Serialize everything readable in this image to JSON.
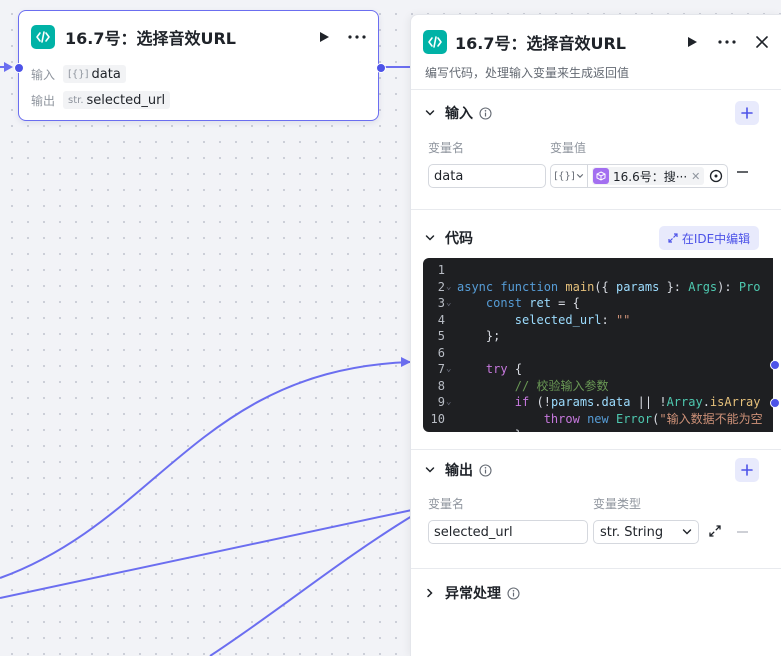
{
  "node": {
    "title": "16.7号：选择音效URL",
    "input_label": "输入",
    "input_type": "[{}]",
    "input_name": "data",
    "output_label": "输出",
    "output_type": "str.",
    "output_name": "selected_url"
  },
  "panel": {
    "title": "16.7号：选择音效URL",
    "subtitle": "编写代码，处理输入变量来生成返回值",
    "input_section": {
      "title": "输入",
      "col_name": "变量名",
      "col_value": "变量值",
      "var_name": "data",
      "type_tag": "[{}]",
      "ref_label": "16.6号：搜···"
    },
    "code_section": {
      "title": "代码",
      "ide_button": "在IDE中编辑",
      "lines": [
        {
          "n": "1",
          "fold": "",
          "html": ""
        },
        {
          "n": "2",
          "fold": "v",
          "html": "<span class='kw2'>async</span> <span class='kw2'>function</span> <span class='fn'>main</span>({ <span class='prm'>params</span> }: <span class='typ'>Args</span>): <span class='typ'>Pro</span>"
        },
        {
          "n": "3",
          "fold": "v",
          "html": "    <span class='kw2'>const</span> <span class='prm'>ret</span> = {"
        },
        {
          "n": "4",
          "fold": "",
          "html": "        <span class='prm'>selected_url</span>: <span class='str'>\"\"</span>"
        },
        {
          "n": "5",
          "fold": "",
          "html": "    };"
        },
        {
          "n": "6",
          "fold": "",
          "html": ""
        },
        {
          "n": "7",
          "fold": "v",
          "html": "    <span class='kw'>try</span> {"
        },
        {
          "n": "8",
          "fold": "",
          "html": "        <span class='cmt'>// 校验输入参数</span>"
        },
        {
          "n": "9",
          "fold": "v",
          "html": "        <span class='kw'>if</span> (!<span class='prm'>params</span>.<span class='prm'>data</span> || !<span class='typ'>Array</span>.<span class='fn'>isArray</span>"
        },
        {
          "n": "10",
          "fold": "",
          "html": "            <span class='kw'>throw</span> <span class='kw2'>new</span> <span class='typ'>Error</span>(<span class='str'>\"输入数据不能为空</span>"
        },
        {
          "n": "",
          "fold": "",
          "html": "        }"
        }
      ]
    },
    "output_section": {
      "title": "输出",
      "col_name": "变量名",
      "col_type": "变量类型",
      "var_name": "selected_url",
      "var_type": "str. String"
    },
    "error_section": {
      "title": "异常处理"
    }
  },
  "colors": {
    "accent": "#4d53e8",
    "code_badge": "#00b2a6",
    "ref_badge": "#a36ff0",
    "edge": "#6b6ef0"
  }
}
